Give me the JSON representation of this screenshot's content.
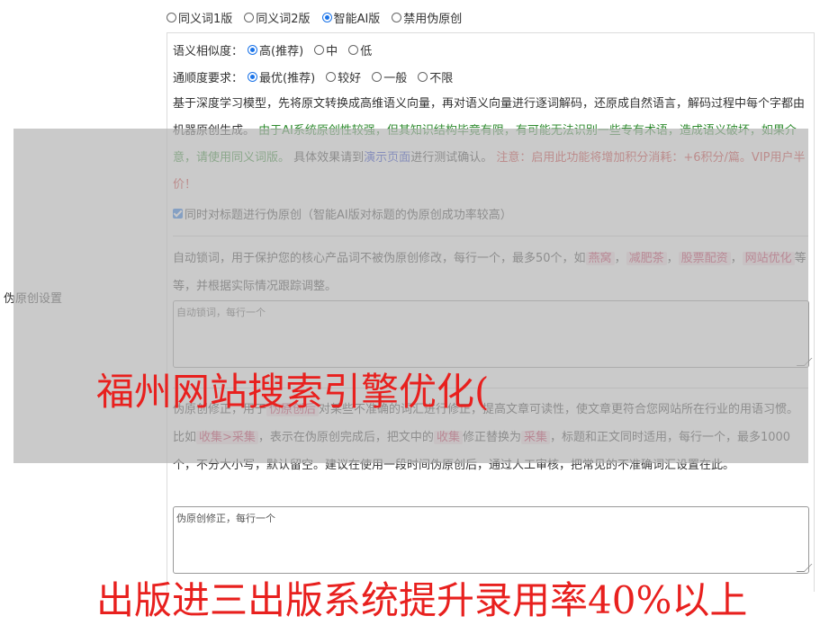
{
  "mode_options": [
    {
      "label": "同义词1版",
      "checked": false
    },
    {
      "label": "同义词2版",
      "checked": false
    },
    {
      "label": "智能AI版",
      "checked": true
    },
    {
      "label": "禁用伪原创",
      "checked": false
    }
  ],
  "similarity": {
    "label": "语义相似度：",
    "options": [
      {
        "label": "高(推荐)",
        "checked": true
      },
      {
        "label": "中",
        "checked": false
      },
      {
        "label": "低",
        "checked": false
      }
    ]
  },
  "fluency": {
    "label": "通顺度要求：",
    "options": [
      {
        "label": "最优(推荐)",
        "checked": true
      },
      {
        "label": "较好",
        "checked": false
      },
      {
        "label": "一般",
        "checked": false
      },
      {
        "label": "不限",
        "checked": false
      }
    ]
  },
  "ai_desc": {
    "intro": "基于深度学习模型，先将原文转换成高维语义向量，再对语义向量进行逐词解码，还原成自然语言，解码过程中每个字都由机器原创生成。",
    "warning_green": "由于AI系统原创性较强，但其知识结构毕竟有限，有可能无法识别一些专有术语，造成语义破坏，如果介意，请使用同义词版。",
    "effect_prefix": "具体效果请到",
    "effect_link": "演示页面",
    "effect_suffix": "进行测试确认。",
    "notice_red": "注意：启用此功能将增加积分消耗：+6积分/篇。VIP用户半价！"
  },
  "title_checkbox": {
    "label": "同时对标题进行伪原创（智能AI版对标题的伪原创成功率较高）",
    "checked": true
  },
  "lock_words": {
    "desc_prefix": "自动锁词，用于保护您的核心产品词不被伪原创修改，每行一个，最多50个，如",
    "examples": [
      "燕窝",
      "减肥茶",
      "股票配资",
      "网站优化"
    ],
    "sep": "，",
    "desc_suffix": "等等，并根据实际情况跟踪调整。",
    "placeholder": "自动锁词，每行一个"
  },
  "correction": {
    "p1": "伪原创修正，用于",
    "tag1": "伪原创后",
    "p2": "对某些不准确的词汇进行修正，提高文章可读性，使文章更符合您网站所在行业的用语习惯。比如",
    "tag2": "收集>采集",
    "p3": "，表示在伪原创完成后，把文中的",
    "tag3": "收集",
    "p4": "修正替换为",
    "tag4": "采集",
    "p5": "，标题和正文同时适用，每行一个，最多1000个，不分大小写，默认留空。建议在使用一段时间伪原创后，通过人工审核，把常见的不准确词汇设置在此。",
    "placeholder": "伪原创修正，每行一个"
  },
  "side_label": "伪原创设置",
  "watermark_1": "福州网站搜索引擎优化(",
  "watermark_2": "出版进三出版系统提升录用率40%以上",
  "colors": {
    "accent": "#1a73e8",
    "green": "#2e8b2e",
    "red": "#d03030",
    "link": "#1a33cc",
    "watermark": "#e8201e"
  }
}
